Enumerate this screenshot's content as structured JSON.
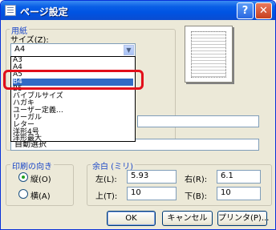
{
  "window": {
    "title": "ページ設定",
    "help": "?",
    "close": "✕"
  },
  "paper": {
    "group_label": "用紙",
    "size_label": "サイズ(Z):",
    "size_value": "A4",
    "options": [
      "A3",
      "A4",
      "A5",
      "B4",
      "B5",
      "バイブルサイズ",
      "ハガキ",
      "ユーザー定義…",
      "リーガル",
      "レター",
      "洋形4号",
      "洋形最大"
    ],
    "selected_option": "B4",
    "source_value": "自動選択"
  },
  "orientation": {
    "group_label": "印刷の向き",
    "portrait": "縦(O)",
    "landscape": "横(A)",
    "selected": "portrait"
  },
  "margins": {
    "group_label": "余白 (ミリ)",
    "left_label": "左(L):",
    "left_value": "5.93",
    "right_label": "右(R):",
    "right_value": "6.1",
    "top_label": "上(T):",
    "top_value": "10",
    "bottom_label": "下(B):",
    "bottom_value": "10"
  },
  "buttons": {
    "ok": "OK",
    "cancel": "キャンセル",
    "printer": "プリンタ(P)..."
  },
  "annotation_color": "#e20f1b",
  "selection_color": "#316ac5"
}
